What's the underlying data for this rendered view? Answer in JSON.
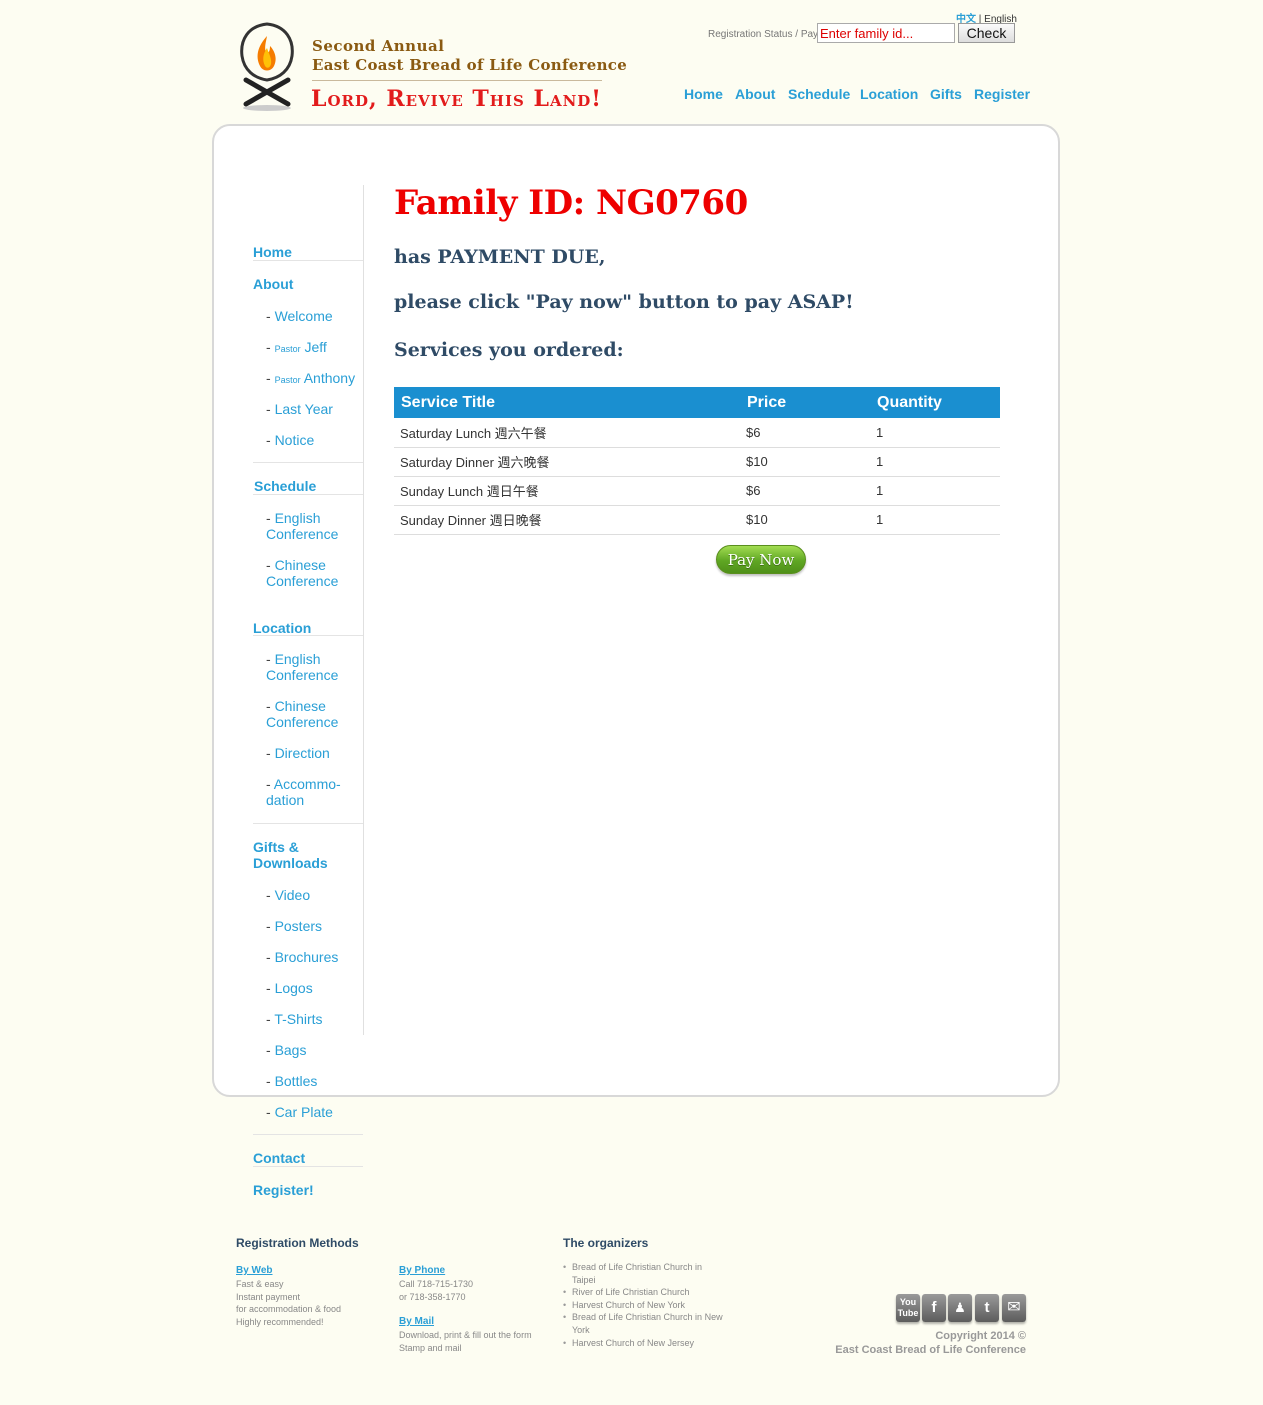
{
  "header": {
    "site_line1": "Second Annual",
    "site_line2": "East Coast Bread of Life Conference",
    "slogan": "Lord, Revive This Land!",
    "lang_zh": "中文",
    "lang_separator": " | ",
    "lang_en": "English",
    "registration_label": "Registration Status / Pay:",
    "family_id_placeholder": "Enter family id...",
    "check_label": "Check"
  },
  "nav": [
    "Home",
    "About",
    "Schedule",
    "Location",
    "Gifts",
    "Register"
  ],
  "sidebar": {
    "home": "Home",
    "about": "About",
    "about_items": [
      "Welcome",
      "Jeff",
      "Anthony",
      "Last Year",
      "Notice"
    ],
    "pastor_prefix": "Pastor",
    "schedule": "Schedule",
    "schedule_items": [
      "English Conference",
      "Chinese Conference"
    ],
    "location": "Location",
    "location_items": [
      "English Conference",
      "Chinese Conference",
      "Direction",
      "Accommo-dation"
    ],
    "gifts": "Gifts & Downloads",
    "gifts_items": [
      "Video",
      "Posters",
      "Brochures",
      "Logos",
      "T-Shirts",
      "Bags",
      "Bottles",
      "Car Plate"
    ],
    "contact": "Contact",
    "register": "Register!"
  },
  "main": {
    "family_heading": "Family ID: NG0760",
    "payment_due": "has PAYMENT DUE,",
    "please_pay": "please click \"Pay now\" button to pay ASAP!",
    "services_heading": "Services you ordered:",
    "table_headers": [
      "Service Title",
      "Price",
      "Quantity"
    ],
    "table_rows": [
      [
        "Saturday Lunch 週六午餐",
        "$6",
        "1"
      ],
      [
        "Saturday Dinner 週六晚餐",
        "$10",
        "1"
      ],
      [
        "Sunday Lunch 週日午餐",
        "$6",
        "1"
      ],
      [
        "Sunday Dinner 週日晚餐",
        "$10",
        "1"
      ]
    ],
    "pay_now_label": "Pay Now"
  },
  "footer": {
    "methods_heading": "Registration Methods",
    "by_web": "By Web",
    "by_web_lines": [
      "Fast & easy",
      "Instant payment",
      "for accommodation & food",
      "Highly recommended!"
    ],
    "by_phone": "By Phone",
    "by_phone_lines": [
      "Call 718-715-1730",
      "or 718-358-1770"
    ],
    "by_mail": "By Mail",
    "by_mail_lines": [
      "Download, print & fill out the form",
      "Stamp and mail"
    ],
    "organizers_heading": "The organizers",
    "organizers": [
      "Bread of Life Christian Church in Taipei",
      "River of Life Christian Church",
      "Harvest Church of New York",
      "Bread of Life Christian Church in New York",
      "Harvest Church of New Jersey"
    ],
    "social_icons": [
      "youtube-icon",
      "facebook-icon",
      "myspace-icon",
      "twitter-icon",
      "email-icon"
    ],
    "copyright_line1": "Copyright 2014 ©",
    "copyright_line2": "East Coast Bread of Life Conference"
  },
  "colors": {
    "link_blue": "#2a9fd6",
    "heading_red": "#e00000",
    "table_header_blue": "#1a8fd0",
    "pay_green": "#5fa623",
    "background": "#fdfdf2"
  }
}
